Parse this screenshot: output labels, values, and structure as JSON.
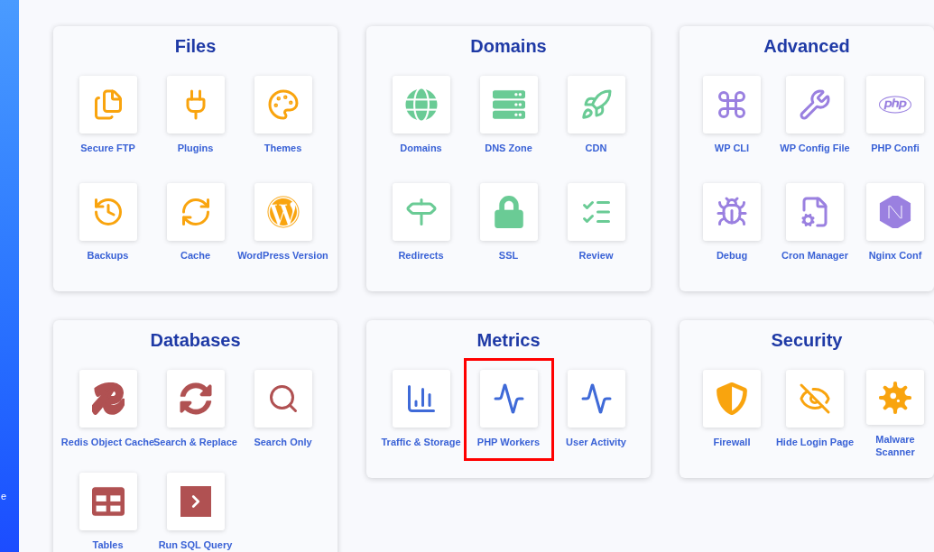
{
  "sidebar": {
    "text": "e"
  },
  "sections": [
    {
      "title": "Files",
      "color": "#f9a40e",
      "items": [
        {
          "label": "Secure FTP",
          "highlighted": false
        },
        {
          "label": "Plugins",
          "highlighted": false
        },
        {
          "label": "Themes",
          "highlighted": false
        },
        {
          "label": "Backups",
          "highlighted": false
        },
        {
          "label": "Cache",
          "highlighted": false
        },
        {
          "label": "WordPress Version",
          "highlighted": false
        }
      ]
    },
    {
      "title": "Domains",
      "color": "#6acb95",
      "items": [
        {
          "label": "Domains",
          "highlighted": false
        },
        {
          "label": "DNS Zone",
          "highlighted": false
        },
        {
          "label": "CDN",
          "highlighted": false
        },
        {
          "label": "Redirects",
          "highlighted": false
        },
        {
          "label": "SSL",
          "highlighted": false
        },
        {
          "label": "Review",
          "highlighted": false
        }
      ]
    },
    {
      "title": "Advanced",
      "color": "#9a80e0",
      "items": [
        {
          "label": "WP CLI",
          "highlighted": false
        },
        {
          "label": "WP Config File",
          "highlighted": false
        },
        {
          "label": "PHP Confi",
          "highlighted": false
        },
        {
          "label": "Debug",
          "highlighted": false
        },
        {
          "label": "Cron Manager",
          "highlighted": false
        },
        {
          "label": "Nginx Conf",
          "highlighted": false
        }
      ]
    },
    {
      "title": "Databases",
      "color": "#b05152",
      "items": [
        {
          "label": "Redis Object Cache",
          "highlighted": false
        },
        {
          "label": "Search & Replace",
          "highlighted": false
        },
        {
          "label": "Search Only",
          "highlighted": false
        },
        {
          "label": "Tables",
          "highlighted": false
        },
        {
          "label": "Run SQL Query",
          "highlighted": false
        }
      ]
    },
    {
      "title": "Metrics",
      "color": "#3f6ad8",
      "items": [
        {
          "label": "Traffic & Storage",
          "highlighted": false
        },
        {
          "label": "PHP Workers",
          "highlighted": true
        },
        {
          "label": "User Activity",
          "highlighted": false
        }
      ]
    },
    {
      "title": "Security",
      "color": "#f9a40e",
      "items": [
        {
          "label": "Firewall",
          "highlighted": false
        },
        {
          "label": "Hide Login Page",
          "highlighted": false
        },
        {
          "label": "Malware Scanner",
          "highlighted": false
        }
      ]
    }
  ]
}
